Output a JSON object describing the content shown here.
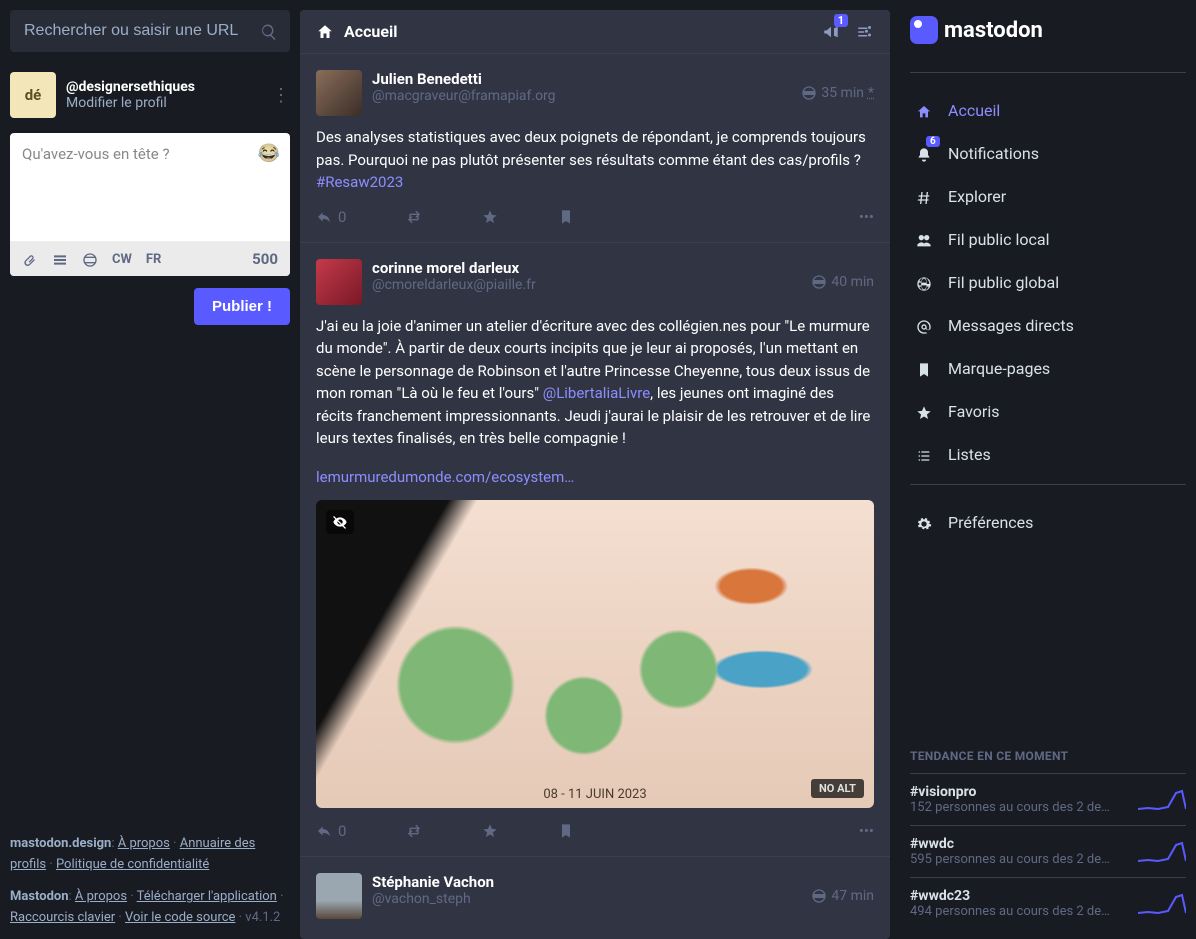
{
  "search": {
    "placeholder": "Rechercher ou saisir une URL"
  },
  "compose": {
    "avatar_text": "dé",
    "handle": "@designersethiques",
    "edit_profile": "Modifier le profil",
    "placeholder": "Qu'avez-vous en tête ?",
    "cw": "CW",
    "lang": "FR",
    "char_count": "500",
    "publish": "Publier !"
  },
  "header": {
    "title": "Accueil",
    "announce_badge": "1"
  },
  "posts": [
    {
      "display_name": "Julien Benedetti",
      "acct": "@macgraveur@framapiaf.org",
      "time": "35 min ",
      "time_suffix": "*",
      "body_plain": "Des analyses statistiques avec deux poignets de répondant, je comprends toujours pas. Pourquoi ne pas plutôt présenter ses résultats comme étant des cas/profils ? ",
      "hashtag": "#Resaw2023",
      "reply_count": "0",
      "has_media": false
    },
    {
      "display_name": "corinne morel darleux",
      "acct": "@cmoreldarleux@piaille.fr",
      "time": "40 min",
      "body_before_mention": "J'ai eu la joie d'animer un atelier d'écriture avec des collégien.nes pour \"Le murmure du monde\". À partir de deux courts incipits que je leur ai proposés, l'un mettant en scène le personnage de Robinson et l'autre Princesse Cheyenne, tous deux issus de mon roman \"Là où le feu et l'ours\" ",
      "mention": "@LibertaliaLivre",
      "body_after_mention": ", les jeunes ont imaginé des récits franchement impressionnants. Jeudi j'aurai le plaisir de les retrouver et de lire leurs textes finalisés, en très belle compagnie !",
      "link": "lemurmuredumonde.com/ecosystem…",
      "media_date": "08 - 11 JUIN 2023",
      "noalt": "NO ALT",
      "reply_count": "0",
      "has_media": true
    },
    {
      "display_name": "Stéphanie Vachon",
      "acct": "@vachon_steph",
      "time": "47 min",
      "has_media": false
    }
  ],
  "logo_text": "mastodon",
  "nav": [
    {
      "label": "Accueil",
      "icon": "home",
      "active": true
    },
    {
      "label": "Notifications",
      "icon": "bell",
      "badge": "6"
    },
    {
      "label": "Explorer",
      "icon": "hash"
    },
    {
      "label": "Fil public local",
      "icon": "users"
    },
    {
      "label": "Fil public global",
      "icon": "globe"
    },
    {
      "label": "Messages directs",
      "icon": "at"
    },
    {
      "label": "Marque-pages",
      "icon": "bookmark"
    },
    {
      "label": "Favoris",
      "icon": "star"
    },
    {
      "label": "Listes",
      "icon": "list"
    }
  ],
  "nav_prefs": "Préférences",
  "trends_title": "TENDANCE EN CE MOMENT",
  "trends": [
    {
      "tag": "#visionpro",
      "sub": "152 personnes au cours des 2 de…"
    },
    {
      "tag": "#wwdc",
      "sub": "595 personnes au cours des 2 de…"
    },
    {
      "tag": "#wwdc23",
      "sub": "494 personnes au cours des 2 de…"
    }
  ],
  "footer": {
    "site": "mastodon.design",
    "about": "À propos",
    "directory": "Annuaire des profils",
    "privacy": "Politique de confidentialité",
    "app_name": "Mastodon",
    "about2": "À propos",
    "download": "Télécharger l'application",
    "shortcuts": "Raccourcis clavier",
    "source": "Voir le code source",
    "version": "v4.1.2"
  }
}
